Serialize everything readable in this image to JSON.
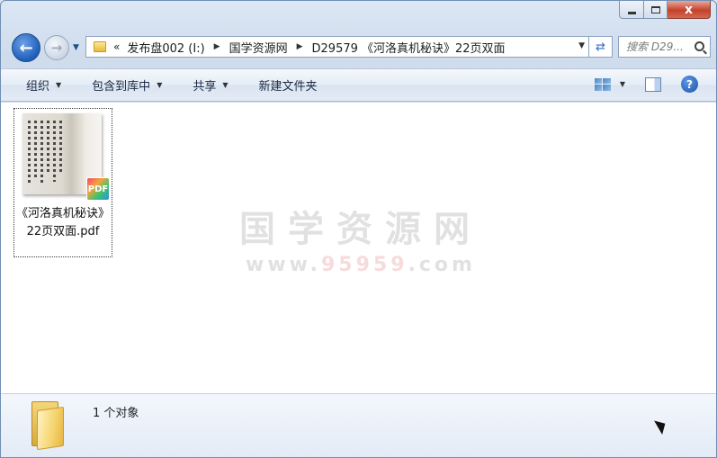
{
  "window": {
    "min_label": "",
    "max_label": "",
    "close_label": "x"
  },
  "address": {
    "chevrons": "«",
    "crumbs": [
      "发布盘002 (I:)",
      "国学资源网",
      "D29579 《河洛真机秘诀》22页双面"
    ],
    "search_placeholder": "搜索 D29..."
  },
  "toolbar": {
    "organize": "组织",
    "include_library": "包含到库中",
    "share": "共享",
    "new_folder": "新建文件夹"
  },
  "files": [
    {
      "name": "《河洛真机秘诀》22页双面.pdf",
      "badge": "PDF"
    }
  ],
  "watermark": {
    "title": "国学资源网",
    "url_pre": "www.",
    "url_red": "95959",
    "url_post": ".com"
  },
  "details": {
    "count_text": "1 个对象"
  }
}
